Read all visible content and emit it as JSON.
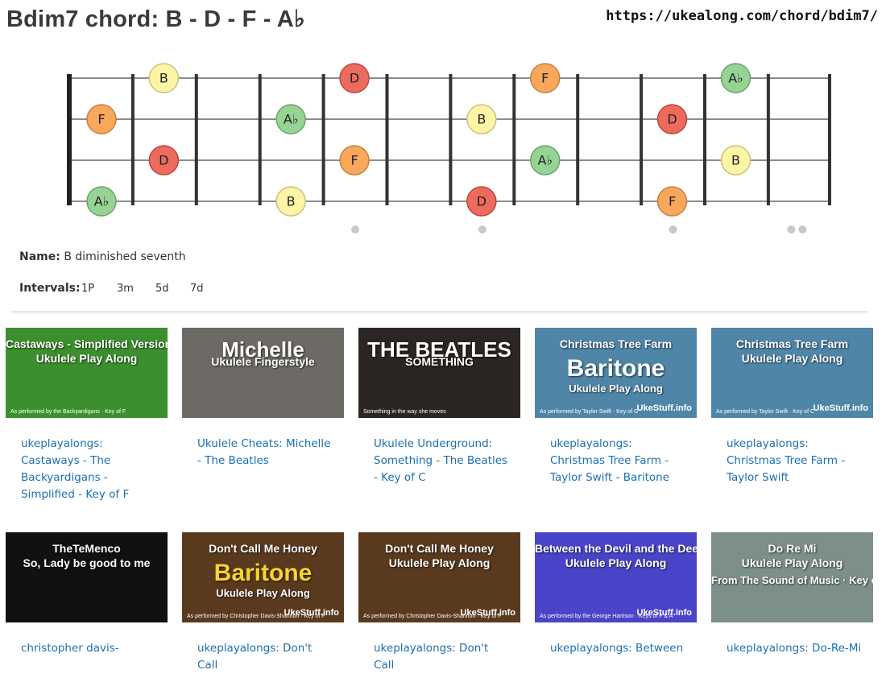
{
  "header": {
    "title": "Bdim7 chord: B - D - F - A♭",
    "url": "https://ukealong.com/chord/bdim7/"
  },
  "fretboard": {
    "strings": 4,
    "frets": 12,
    "inlay_frets": [
      5,
      7,
      10,
      12
    ],
    "notes": [
      {
        "string": 1,
        "fret": 1,
        "label": "B",
        "color": "#fdf5a5"
      },
      {
        "string": 1,
        "fret": 4,
        "label": "D",
        "color": "#ec6b5e"
      },
      {
        "string": 1,
        "fret": 7,
        "label": "F",
        "color": "#f7a85a"
      },
      {
        "string": 1,
        "fret": 10,
        "label": "A♭",
        "color": "#96d394"
      },
      {
        "string": 2,
        "fret": 0,
        "label": "F",
        "color": "#f7a85a"
      },
      {
        "string": 2,
        "fret": 3,
        "label": "A♭",
        "color": "#96d394"
      },
      {
        "string": 2,
        "fret": 6,
        "label": "B",
        "color": "#fdf5a5"
      },
      {
        "string": 2,
        "fret": 9,
        "label": "D",
        "color": "#ec6b5e"
      },
      {
        "string": 3,
        "fret": 1,
        "label": "D",
        "color": "#ec6b5e"
      },
      {
        "string": 3,
        "fret": 4,
        "label": "F",
        "color": "#f7a85a"
      },
      {
        "string": 3,
        "fret": 7,
        "label": "A♭",
        "color": "#96d394"
      },
      {
        "string": 3,
        "fret": 10,
        "label": "B",
        "color": "#fdf5a5"
      },
      {
        "string": 4,
        "fret": 0,
        "label": "A♭",
        "color": "#96d394"
      },
      {
        "string": 4,
        "fret": 3,
        "label": "B",
        "color": "#fdf5a5"
      },
      {
        "string": 4,
        "fret": 6,
        "label": "D",
        "color": "#ec6b5e"
      },
      {
        "string": 4,
        "fret": 9,
        "label": "F",
        "color": "#f7a85a"
      }
    ]
  },
  "chord_info": {
    "name_label": "Name:",
    "name_value": "B diminished seventh",
    "intervals_label": "Intervals:",
    "intervals": [
      "1P",
      "3m",
      "5d",
      "7d"
    ]
  },
  "videos": [
    {
      "link": "ukeplayalongs: Castaways - The Backyardigans - Simplified - Key of F",
      "thumb_line1": "Castaways - Simplified Version",
      "thumb_line2": "Ukulele Play Along",
      "thumb_line3": "",
      "thumb_foot": "As performed by the Backyardigans · Key of F",
      "thumb_brand": "",
      "bg": "#3c8f2e"
    },
    {
      "link": "Ukulele Cheats: Michelle - The Beatles",
      "thumb_line1": "Michelle",
      "thumb_line2": "Ukulele Fingerstyle",
      "thumb_line3": "",
      "thumb_foot": "",
      "thumb_brand": "",
      "bg": "#6d6a66"
    },
    {
      "link": "Ukulele Underground: Something - The Beatles - Key of C",
      "thumb_line1": "THE BEATLES",
      "thumb_line2": "SOMETHING",
      "thumb_line3": "",
      "thumb_foot": "Something in the way she moves",
      "thumb_brand": "",
      "bg": "#2b2623"
    },
    {
      "link": "ukeplayalongs: Christmas Tree Farm - Taylor Swift - Baritone",
      "thumb_line1": "Christmas Tree Farm",
      "thumb_line2": "Baritone",
      "thumb_line3": "Ukulele Play Along",
      "thumb_foot": "As performed by Taylor Swift · Key of G",
      "thumb_brand": "UkeStuff.info",
      "bg": "#4f86a8"
    },
    {
      "link": "ukeplayalongs: Christmas Tree Farm - Taylor Swift",
      "thumb_line1": "Christmas Tree Farm",
      "thumb_line2": "Ukulele Play Along",
      "thumb_line3": "",
      "thumb_foot": "As performed by Taylor Swift · Key of C",
      "thumb_brand": "UkeStuff.info",
      "bg": "#4f86a8"
    },
    {
      "link": "christopher davis-",
      "thumb_line1": "TheTeMenco",
      "thumb_line2": "So, Lady be good to me",
      "thumb_line3": "",
      "thumb_foot": "",
      "thumb_brand": "",
      "bg": "#111111"
    },
    {
      "link": "ukeplayalongs: Don't Call",
      "thumb_line1": "Don't Call Me Honey",
      "thumb_line2": "Baritone",
      "thumb_line3": "Ukulele Play Along",
      "thumb_foot": "As performed by Christopher Davis-Shannon · Key of F",
      "thumb_brand": "UkeStuff.info",
      "bg": "#5a3a1e"
    },
    {
      "link": "ukeplayalongs: Don't Call",
      "thumb_line1": "Don't Call Me Honey",
      "thumb_line2": "Ukulele Play Along",
      "thumb_line3": "",
      "thumb_foot": "As performed by Christopher Davis-Shannon · Key of F",
      "thumb_brand": "UkeStuff.info",
      "bg": "#5a3a1e"
    },
    {
      "link": "ukeplayalongs: Between",
      "thumb_line1": "Between the Devil and the Deep Blue Sea",
      "thumb_line2": "Ukulele Play Along",
      "thumb_line3": "",
      "thumb_foot": "As performed by the George Harrison · Keys of F & A",
      "thumb_brand": "UkeStuff.info",
      "bg": "#4a44c8"
    },
    {
      "link": "ukeplayalongs: Do-Re-Mi",
      "thumb_line1": "Do Re Mi",
      "thumb_line2": "Ukulele Play Along",
      "thumb_line3": "From The Sound of Music · Key of C",
      "thumb_foot": "",
      "thumb_brand": "",
      "bg": "#7c8f8a"
    }
  ]
}
